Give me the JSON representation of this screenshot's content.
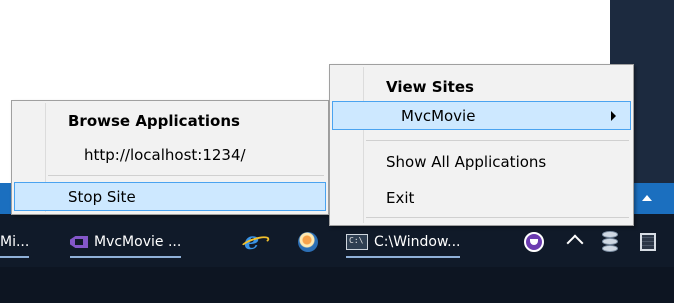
{
  "taskbar": {
    "items": [
      {
        "label": "Mi..."
      },
      {
        "label": "MvcMovie ...",
        "icon": "visual-studio-icon"
      },
      {
        "label": "",
        "icon": "internet-explorer-icon"
      },
      {
        "label": "",
        "icon": "iis-express-icon"
      },
      {
        "label": "C:\\Window...",
        "icon": "command-prompt-icon"
      }
    ],
    "tray_icons": [
      "purple-circle-icon",
      "chevron-up-icon",
      "database-icon",
      "square-icon"
    ]
  },
  "left_menu": {
    "header": "Browse Applications",
    "url": "http://localhost:1234/",
    "stop_site": "Stop Site"
  },
  "right_menu": {
    "header": "View Sites",
    "site": "MvcMovie",
    "show_all": "Show All Applications",
    "exit": "Exit"
  },
  "colors": {
    "taskbar": "#101a29",
    "notification_strip": "#1b6fbf",
    "menu_background": "#f2f2f2",
    "highlight_fill": "#cde8ff",
    "highlight_border": "#4aa3f0"
  }
}
